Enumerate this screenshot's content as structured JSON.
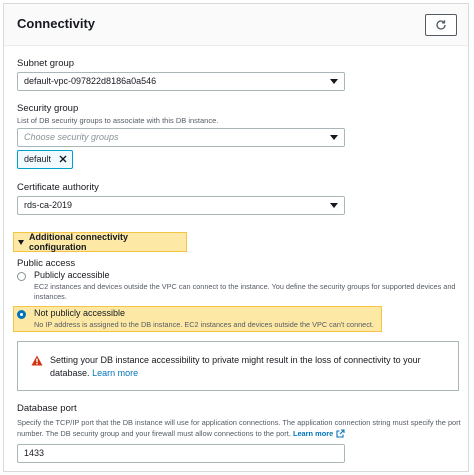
{
  "panel": {
    "title": "Connectivity",
    "refresh_icon": "refresh-icon"
  },
  "subnet": {
    "label": "Subnet group",
    "value": "default-vpc-097822d8186a0a546"
  },
  "security": {
    "label": "Security group",
    "description": "List of DB security groups to associate with this DB instance.",
    "placeholder": "Choose security groups",
    "token": "default"
  },
  "certificate": {
    "label": "Certificate authority",
    "value": "rds-ca-2019"
  },
  "additional": {
    "label": "Additional connectivity configuration"
  },
  "public_access": {
    "label": "Public access",
    "options": [
      {
        "label": "Publicly accessible",
        "description": "EC2 instances and devices outside the VPC can connect to the instance. You define the security groups for supported devices and instances.",
        "selected": false
      },
      {
        "label": "Not publicly accessible",
        "description": "No IP address is assigned to the DB instance. EC2 instances and devices outside the VPC can't connect.",
        "selected": true
      }
    ]
  },
  "alert": {
    "text": "Setting your DB instance accessibility to private might result in the loss of connectivity to your database.",
    "link": "Learn more",
    "icon": "warning-icon"
  },
  "port": {
    "label": "Database port",
    "description": "Specify the TCP/IP port that the DB instance will use for application connections. The application connection string must specify the port number. The DB security group and your firewall must allow connections to the port.",
    "link": "Learn more",
    "value": "1433"
  },
  "colors": {
    "accent": "#0073bb",
    "highlight": "#fde9a5",
    "warning": "#d13212"
  }
}
